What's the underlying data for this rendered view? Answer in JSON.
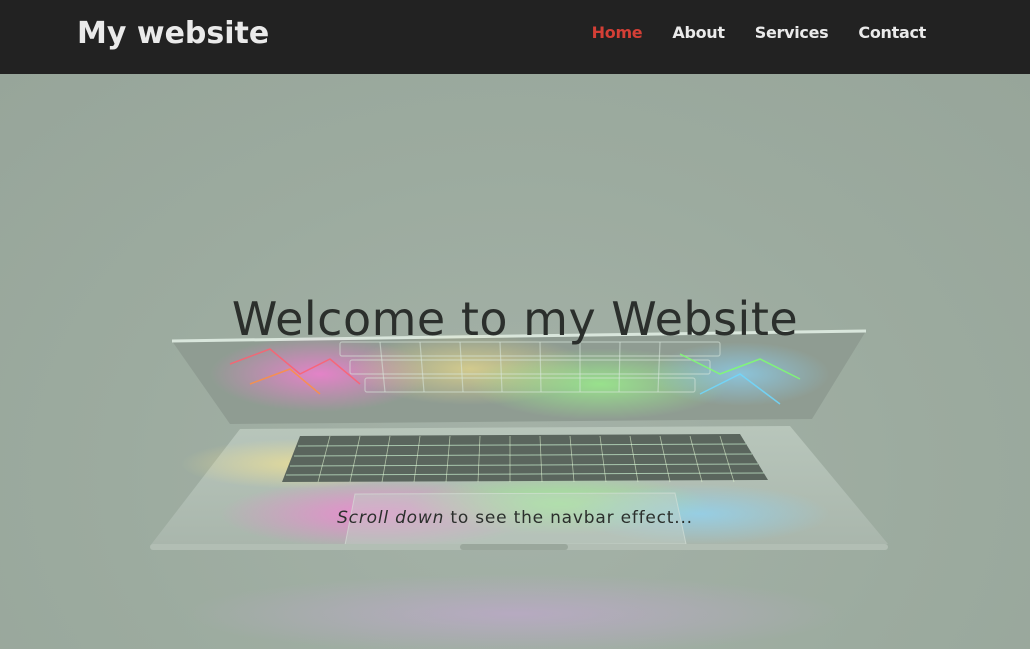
{
  "navbar": {
    "brand": "My website",
    "links": [
      {
        "label": "Home",
        "active": true
      },
      {
        "label": "About",
        "active": false
      },
      {
        "label": "Services",
        "active": false
      },
      {
        "label": "Contact",
        "active": false
      }
    ]
  },
  "hero": {
    "title": "Welcome to my Website",
    "subtitle_emphasis": "Scroll down",
    "subtitle_rest": " to see the navbar effect..."
  },
  "colors": {
    "navbar_bg": "#222222",
    "nav_text": "#eaeaea",
    "nav_active": "#d43f36",
    "hero_overlay": "#9eaba1"
  }
}
